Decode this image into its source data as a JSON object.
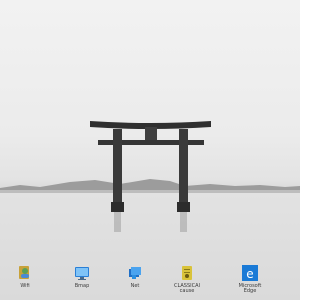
{
  "desktop": {
    "icons": [
      {
        "name": "user-icon",
        "label": "Wifi"
      },
      {
        "name": "monitor-icon",
        "label": "Bmap"
      },
      {
        "name": "network-icon",
        "label": "Net"
      },
      {
        "name": "folder-icon",
        "label": "CLASSICAI\ncause"
      },
      {
        "name": "edge-browser-icon",
        "label": "Microsoft\nEdge"
      }
    ]
  }
}
